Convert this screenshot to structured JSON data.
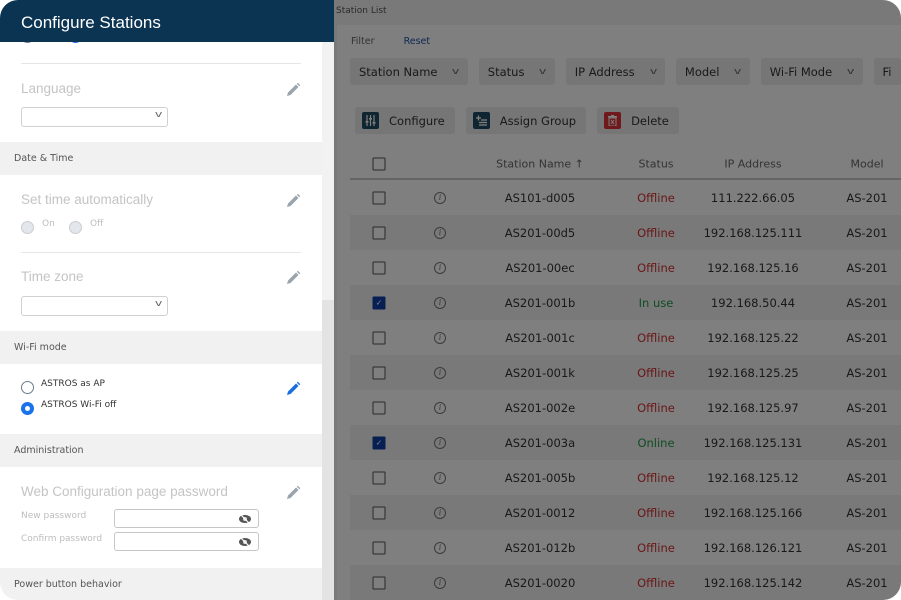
{
  "panel": {
    "title": "Configure Stations",
    "language": {
      "label": "Language",
      "value": ""
    },
    "sections": {
      "date_time": "Date & Time",
      "wifi_mode": "Wi-Fi mode",
      "administration": "Administration",
      "power_button": "Power button behavior"
    },
    "set_time_auto": {
      "label": "Set time automatically",
      "options": [
        "On",
        "Off"
      ],
      "selected": null
    },
    "time_zone": {
      "label": "Time zone",
      "value": ""
    },
    "wifi": {
      "options": [
        "ASTROS as AP",
        "ASTROS Wi-Fi off"
      ],
      "selected": "ASTROS Wi-Fi off"
    },
    "web_password": {
      "label": "Web Configuration page password",
      "new_label": "New password",
      "confirm_label": "Confirm password",
      "new_value": "",
      "confirm_value": ""
    },
    "accent_color": "#1a73e8",
    "header_color": "#0b3352"
  },
  "station_list": {
    "title": "Station List",
    "filter_label": "Filter",
    "reset_label": "Reset",
    "filters": [
      "Station Name",
      "Status",
      "IP Address",
      "Model",
      "Wi-Fi Mode",
      "Fi"
    ],
    "actions": {
      "configure": "Configure",
      "assign_group": "Assign Group",
      "delete": "Delete"
    },
    "columns": {
      "station_name": "Station Name ↑",
      "status": "Status",
      "ip": "IP Address",
      "model": "Model"
    },
    "rows": [
      {
        "name": "AS101-d005",
        "status": "Offline",
        "ip": "111.222.66.05",
        "model": "AS-201",
        "checked": false
      },
      {
        "name": "AS201-00d5",
        "status": "Offline",
        "ip": "192.168.125.111",
        "model": "AS-201",
        "checked": false
      },
      {
        "name": "AS201-00ec",
        "status": "Offline",
        "ip": "192.168.125.16",
        "model": "AS-201",
        "checked": false
      },
      {
        "name": "AS201-001b",
        "status": "In use",
        "ip": "192.168.50.44",
        "model": "AS-201",
        "checked": true
      },
      {
        "name": "AS201-001c",
        "status": "Offline",
        "ip": "192.168.125.22",
        "model": "AS-201",
        "checked": false
      },
      {
        "name": "AS201-001k",
        "status": "Offline",
        "ip": "192.168.125.25",
        "model": "AS-201",
        "checked": false
      },
      {
        "name": "AS201-002e",
        "status": "Offline",
        "ip": "192.168.125.97",
        "model": "AS-201",
        "checked": false
      },
      {
        "name": "AS201-003a",
        "status": "Online",
        "ip": "192.168.125.131",
        "model": "AS-201",
        "checked": true
      },
      {
        "name": "AS201-005b",
        "status": "Offline",
        "ip": "192.168.125.12",
        "model": "AS-201",
        "checked": false
      },
      {
        "name": "AS201-0012",
        "status": "Offline",
        "ip": "192.168.125.166",
        "model": "AS-201",
        "checked": false
      },
      {
        "name": "AS201-012b",
        "status": "Offline",
        "ip": "192.168.126.121",
        "model": "AS-201",
        "checked": false
      },
      {
        "name": "AS201-0020",
        "status": "Offline",
        "ip": "192.168.125.142",
        "model": "AS-201",
        "checked": false
      }
    ],
    "status_colors": {
      "Offline": "#d32f2f",
      "Online": "#1f9b46",
      "In use": "#1f9b46"
    }
  }
}
